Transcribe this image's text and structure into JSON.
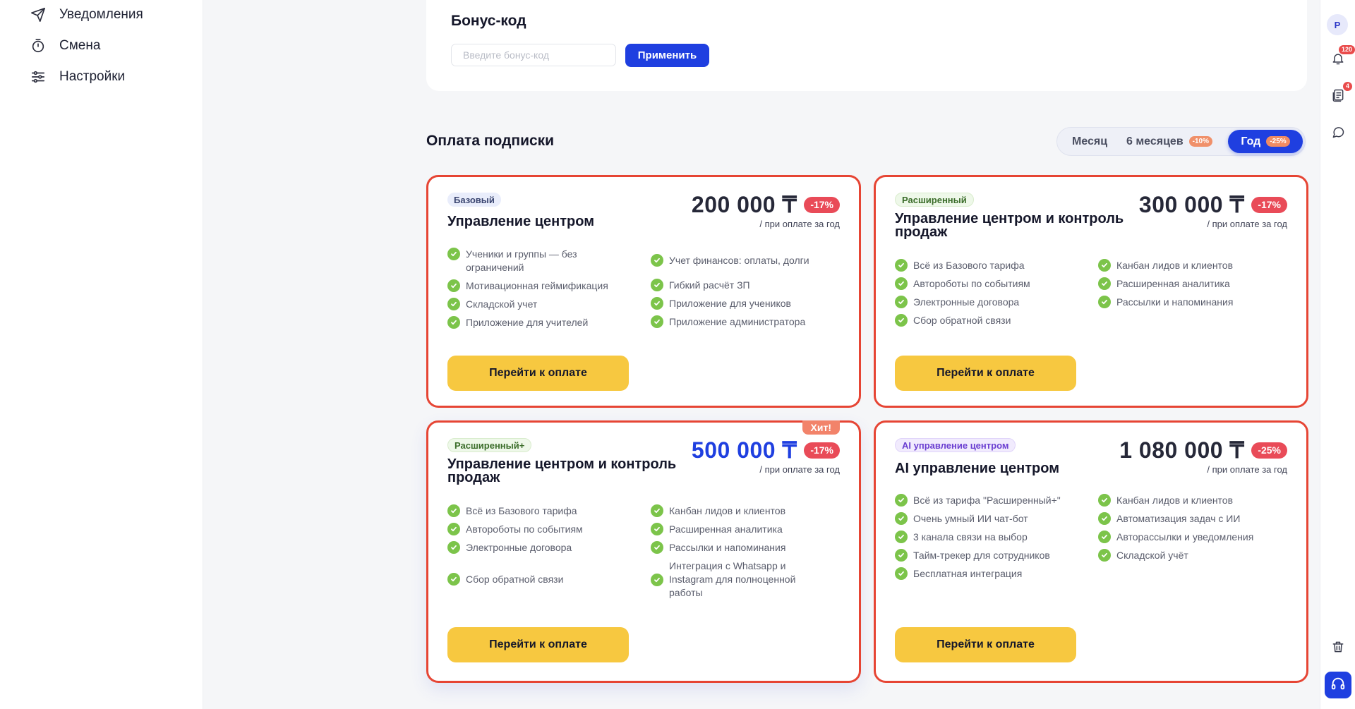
{
  "sidebar": {
    "items": [
      {
        "label": "Уведомления",
        "icon": "send-icon"
      },
      {
        "label": "Смена",
        "icon": "timer-icon"
      },
      {
        "label": "Настройки",
        "icon": "sliders-icon"
      }
    ]
  },
  "right_rail": {
    "avatar_letter": "P",
    "notifications_count": "120",
    "docs_count": "4"
  },
  "bonus": {
    "title": "Бонус-код",
    "placeholder": "Введите бонус-код",
    "value": "",
    "apply_label": "Применить"
  },
  "subscription": {
    "title": "Оплата подписки",
    "periods": [
      {
        "label": "Месяц",
        "discount": ""
      },
      {
        "label": "6 месяцев",
        "discount": "-10%"
      },
      {
        "label": "Год",
        "discount": "-25%",
        "active": true
      }
    ]
  },
  "plans": [
    {
      "tag": "Базовый",
      "name": "Управление центром",
      "price": "200 000 ₸",
      "discount": "-17%",
      "note": "/ при оплате за год",
      "features_left": [
        "Ученики и группы — без ограничений",
        "Мотивационная геймификация",
        "Складской учет",
        "Приложение для учителей"
      ],
      "features_right": [
        "Учет финансов: оплаты, долги",
        "Гибкий расчёт ЗП",
        "Приложение для учеников",
        "Приложение администратора"
      ],
      "button": "Перейти к оплате"
    },
    {
      "tag": "Расширенный",
      "name": "Управление центром и контроль продаж",
      "price": "300 000 ₸",
      "discount": "-17%",
      "note": "/ при оплате за год",
      "features_left": [
        "Всё из Базового тарифа",
        "Автороботы по событиям",
        "Электронные договора",
        "Сбор обратной связи"
      ],
      "features_right": [
        "Канбан лидов и клиентов",
        "Расширенная аналитика",
        "Рассылки и напоминания"
      ],
      "button": "Перейти к оплате"
    },
    {
      "tag": "Расширенный+",
      "badge": "Хит!",
      "name": "Управление центром и контроль продаж",
      "price": "500 000 ₸",
      "discount": "-17%",
      "note": "/ при оплате за год",
      "features_left": [
        "Всё из Базового тарифа",
        "Автороботы по событиям",
        "Электронные договора",
        "Сбор обратной связи"
      ],
      "features_right": [
        "Канбан лидов и клиентов",
        "Расширенная аналитика",
        "Рассылки и напоминания",
        "Интеграция с Whatsapp и Instagram для полноценной работы"
      ],
      "button": "Перейти к оплате"
    },
    {
      "tag": "AI управление центром",
      "name": "AI управление центром",
      "price": "1 080 000 ₸",
      "discount": "-25%",
      "note": "/ при оплате за год",
      "features_left": [
        "Всё из тарифа \"Расширенный+\"",
        "Очень умный ИИ чат-бот",
        "3 канала связи на выбор",
        "Тайм-трекер для сотрудников",
        "Бесплатная интеграция"
      ],
      "features_right": [
        "Канбан лидов и клиентов",
        "Автоматизация задач с ИИ",
        "Авторассылки и уведомления",
        "Складской учёт"
      ],
      "button": "Перейти к оплате"
    }
  ],
  "colors": {
    "accent": "#1f3fe0",
    "card_border": "#e64534",
    "pay_button": "#f7c840",
    "check": "#7cc44a",
    "discount": "#e94b58"
  }
}
